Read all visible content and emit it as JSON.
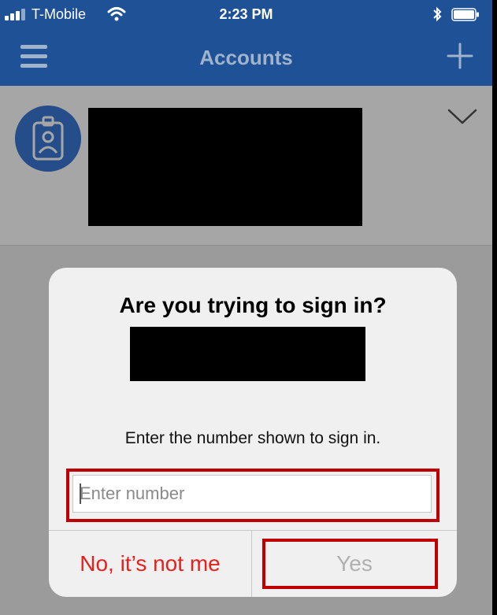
{
  "status_bar": {
    "carrier": "T-Mobile",
    "time": "2:23 PM"
  },
  "nav": {
    "title": "Accounts"
  },
  "dialog": {
    "title": "Are you trying to sign in?",
    "message": "Enter the number shown to sign in.",
    "input_placeholder": "Enter number",
    "input_value": "",
    "no_label": "No, it’s not me",
    "yes_label": "Yes"
  },
  "colors": {
    "header_blue": "#1f5196",
    "deny_red": "#e8201c",
    "highlight_red": "#c00000",
    "disabled_gray": "#b0b0b0"
  },
  "icons": [
    "signal-icon",
    "wifi-icon",
    "bluetooth-icon",
    "battery-icon",
    "hamburger-menu-icon",
    "add-icon",
    "badge-avatar-icon",
    "chevron-down-icon"
  ]
}
